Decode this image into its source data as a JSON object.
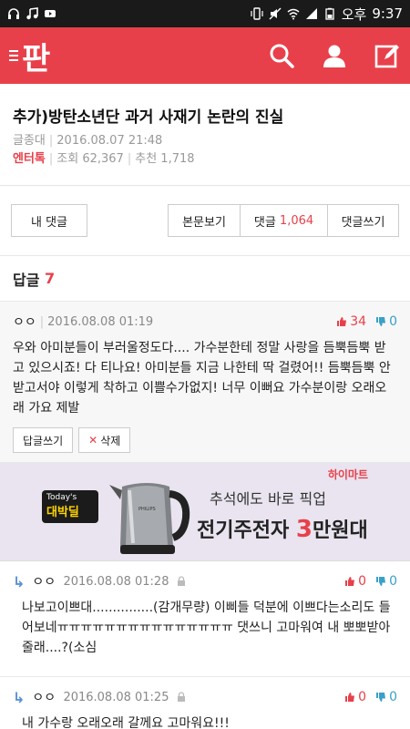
{
  "status_bar": {
    "ampm": "오후",
    "time": "9:37"
  },
  "app": {
    "logo": "판"
  },
  "post": {
    "title": "추가)방탄소년단 과거 사재기 논란의 진실",
    "author": "글종대",
    "date": "2016.08.07 21:48",
    "category": "엔터톡",
    "views_label": "조회",
    "views": "62,367",
    "recommend_label": "추천",
    "recommend": "1,718"
  },
  "toolbar": {
    "my_comments": "내 댓글",
    "view_body": "본문보기",
    "comments_label": "댓글",
    "comments_count": "1,064",
    "write_comment": "댓글쓰기"
  },
  "replies_header": {
    "label": "답글",
    "count": "7"
  },
  "main_comment": {
    "user": "ㅇㅇ",
    "date": "2016.08.08 01:19",
    "up": "34",
    "down": "0",
    "text": "우와 아미분들이 부러울정도다.... 가수분한테 정말 사랑을 듬뿍듬뿍 받고 있으시죠! 다 티나요! 아미분들 지금 나한테 딱 걸렸어!! 듬뿍듬뿍 안받고서야 이렇게 착하고 이쁠수가없지! 너무 이뻐요 가수분이랑 오래오래 가요 제발",
    "reply_btn": "답글쓰기",
    "delete_btn": "삭제"
  },
  "ad": {
    "badge_small": "Today's",
    "badge_big": "대박딜",
    "store": "하이마트",
    "line1": "추석에도 바로 픽업",
    "line2_a": "전기주전자 ",
    "line2_b": "3",
    "line2_c": "만원대",
    "product_brand": "PHILIPS"
  },
  "replies": [
    {
      "user": "ㅇㅇ",
      "date": "2016.08.08 01:28",
      "up": "0",
      "down": "0",
      "text": "나보고이쁘대...............(감개무량) 이삐들 덕분에 이쁘다는소리도 들어보네ㅠㅠㅠㅠㅠㅠㅠㅠㅠㅠㅠㅠㅠㅠㅠ 댓쓰니 고마워여 내 뽀뽀받아줄래....?(소심"
    },
    {
      "user": "ㅇㅇ",
      "date": "2016.08.08 01:25",
      "up": "0",
      "down": "0",
      "text": "내 가수랑 오래오래 갈께요 고마워요!!!"
    }
  ]
}
